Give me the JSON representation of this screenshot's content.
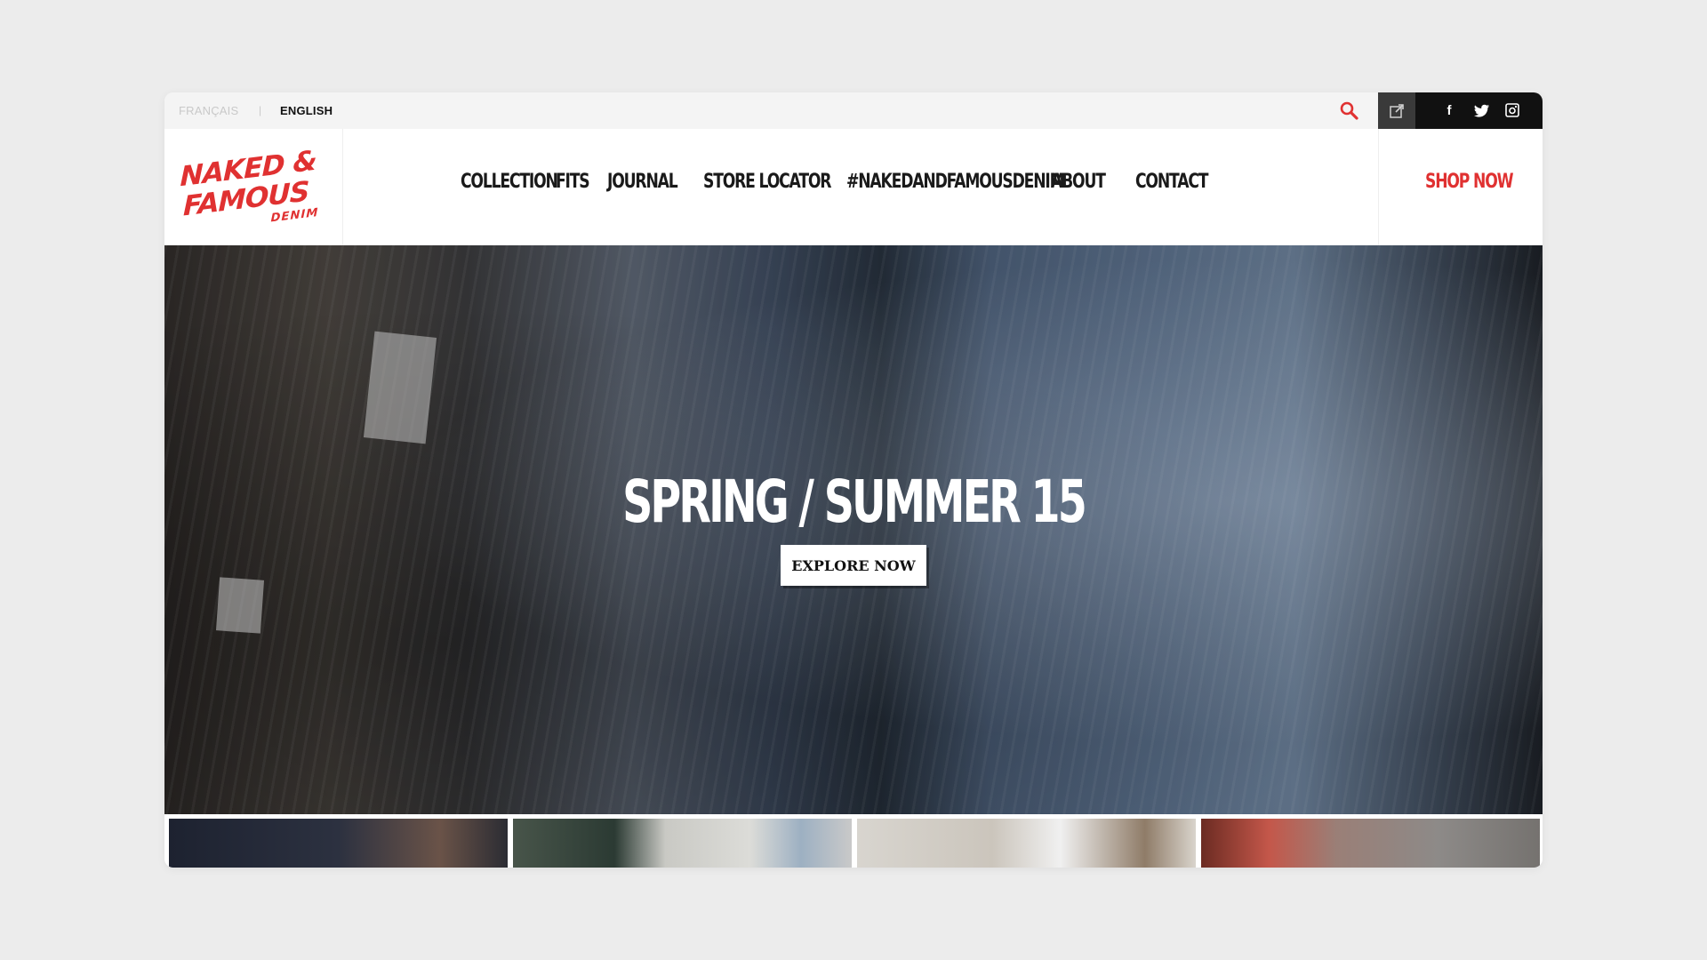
{
  "topbar": {
    "lang_fr": "FRANÇAIS",
    "lang_separator": "|",
    "lang_en": "ENGLISH",
    "search_icon": "search-icon",
    "external_icon": "external-link-icon",
    "social": [
      "facebook-icon",
      "twitter-icon",
      "instagram-icon"
    ],
    "facebook_glyph": "f"
  },
  "brand": {
    "line1": "NAKED &",
    "line2": "FAMOUS",
    "line3": "DENIM"
  },
  "nav": {
    "items": [
      {
        "label": "COLLECTION"
      },
      {
        "label": "FITS"
      },
      {
        "label": "JOURNAL"
      },
      {
        "label": "STORE LOCATOR"
      },
      {
        "label": "#NAKEDANDFAMOUSDENIM"
      },
      {
        "label": "ABOUT"
      },
      {
        "label": "CONTACT"
      }
    ],
    "shop_now": "SHOP NOW"
  },
  "hero": {
    "title": "SPRING / SUMMER 15",
    "cta": "EXPLORE NOW"
  },
  "colors": {
    "accent": "#e03131",
    "background": "#ececec",
    "topbar": "#f4f4f4",
    "dark": "#111111"
  }
}
